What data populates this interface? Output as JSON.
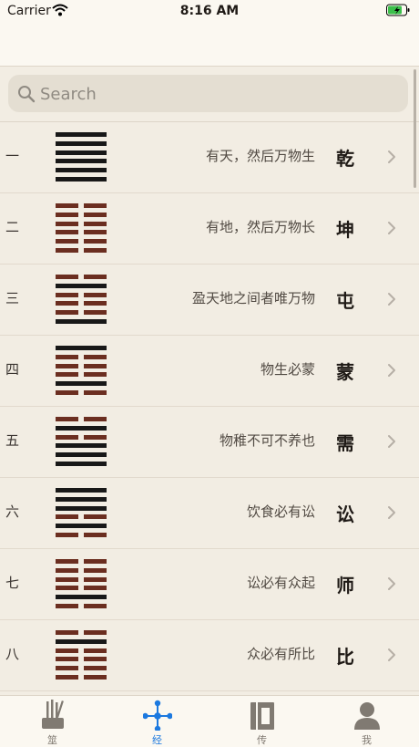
{
  "status_bar": {
    "carrier": "Carrier",
    "time": "8:16 AM",
    "wifi_icon": "wifi-icon",
    "battery_icon": "battery-charging-icon",
    "battery_color": "#3bbf4a"
  },
  "search": {
    "placeholder": "Search",
    "value": ""
  },
  "colors": {
    "yang_line": "#181818",
    "yin_line": "#6b2e20",
    "tab_active": "#1c79df",
    "tab_inactive": "#807a72",
    "background": "#f2ede3"
  },
  "hexagrams": [
    {
      "index": "一",
      "title": "乾",
      "subtitle": "有天，然后万物生",
      "lines": [
        1,
        1,
        1,
        1,
        1,
        1
      ]
    },
    {
      "index": "二",
      "title": "坤",
      "subtitle": "有地，然后万物长",
      "lines": [
        0,
        0,
        0,
        0,
        0,
        0
      ]
    },
    {
      "index": "三",
      "title": "屯",
      "subtitle": "盈天地之间者唯万物",
      "lines": [
        0,
        1,
        0,
        0,
        0,
        1
      ]
    },
    {
      "index": "四",
      "title": "蒙",
      "subtitle": "物生必蒙",
      "lines": [
        1,
        0,
        0,
        0,
        1,
        0
      ]
    },
    {
      "index": "五",
      "title": "需",
      "subtitle": "物稚不可不养也",
      "lines": [
        0,
        1,
        0,
        1,
        1,
        1
      ]
    },
    {
      "index": "六",
      "title": "讼",
      "subtitle": "饮食必有讼",
      "lines": [
        1,
        1,
        1,
        0,
        1,
        0
      ]
    },
    {
      "index": "七",
      "title": "师",
      "subtitle": "讼必有众起",
      "lines": [
        0,
        0,
        0,
        0,
        1,
        0
      ]
    },
    {
      "index": "八",
      "title": "比",
      "subtitle": "众必有所比",
      "lines": [
        0,
        1,
        0,
        0,
        0,
        0
      ]
    }
  ],
  "tabs": [
    {
      "label": "筮",
      "icon": "divination-sticks-icon",
      "active": false
    },
    {
      "label": "经",
      "icon": "network-nodes-icon",
      "active": true
    },
    {
      "label": "传",
      "icon": "book-spine-icon",
      "active": false
    },
    {
      "label": "我",
      "icon": "person-icon",
      "active": false
    }
  ]
}
